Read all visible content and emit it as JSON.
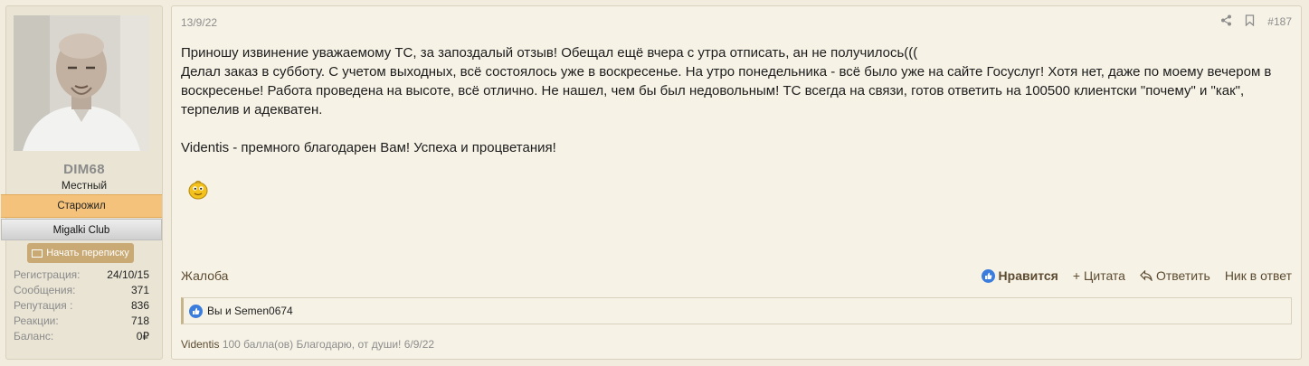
{
  "user": {
    "name": "DIM68",
    "title": "Местный",
    "banner_old": "Старожил",
    "banner_club": "Migalki Club",
    "message_button": "Начать переписку",
    "stats": [
      {
        "label": "Регистрация:",
        "value": "24/10/15"
      },
      {
        "label": "Сообщения:",
        "value": "371"
      },
      {
        "label": "Репутация :",
        "value": "836"
      },
      {
        "label": "Реакции:",
        "value": "718"
      },
      {
        "label": "Баланс:",
        "value": "0₽"
      }
    ]
  },
  "post": {
    "date": "13/9/22",
    "number": "#187",
    "paragraphs": [
      "Приношу извинение уважаемому ТС, за запоздалый отзыв! Обещал ещё вчера с утра отписать, ан не получилось(((",
      "Делал заказ в субботу. С учетом выходных, всё состоялось уже в воскресенье. На утро понедельника - всё было уже на сайте Госуслуг! Хотя нет, даже по моему вечером в воскресенье! Работа проведена на высоте, всё отлично. Не нашел, чем бы был недовольным! ТС всегда на связи, готов ответить на 100500 клиентски \"почему\" и \"как\", терпелив и адекватен.",
      "Videntis - премного благодарен Вам! Успеха и процветания!"
    ],
    "report": "Жалоба",
    "actions": {
      "like": "Нравится",
      "quote": "Цитата",
      "reply": "Ответить",
      "nick": "Ник в ответ"
    },
    "likes_text": "Вы и Semen0674",
    "reputation": {
      "user": "Videntis",
      "text": "100 балла(ов) Благодарю, от души! 6/9/22"
    }
  },
  "colors": {
    "accent": "#5c4b30",
    "banner": "#f4c27a",
    "like": "#3b7ddd"
  }
}
